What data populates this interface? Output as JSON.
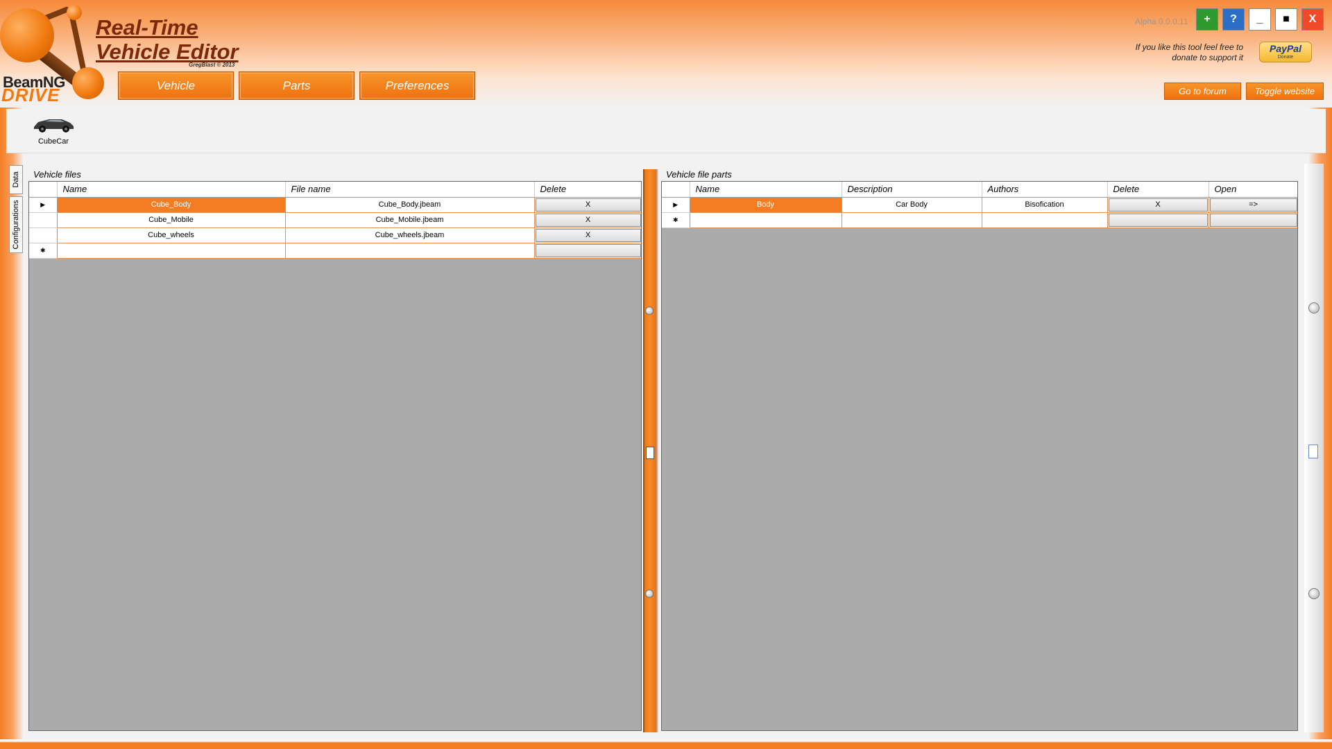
{
  "app": {
    "title_line1": "Real-Time",
    "title_line2": "Vehicle Editor",
    "credit": "GregBlast © 2013",
    "brand_name": "BeamNG",
    "brand_sub": "DRIVE",
    "version": "Alpha 0.0.0.11"
  },
  "nav": {
    "vehicle": "Vehicle",
    "parts": "Parts",
    "preferences": "Preferences"
  },
  "window_controls": {
    "add": "+",
    "help": "?",
    "minimize": "_",
    "maximize": "■",
    "close": "X"
  },
  "donate": {
    "text": "If you like this tool feel free to donate to support it",
    "paypal_label": "PayPal",
    "paypal_sub": "Donate"
  },
  "links": {
    "forum": "Go to forum",
    "toggle_website": "Toggle website"
  },
  "vehicles": [
    {
      "label": "CubeCar"
    }
  ],
  "side_tabs": {
    "data": "Data",
    "configurations": "Configurations"
  },
  "vehicle_files": {
    "title": "Vehicle files",
    "columns": {
      "name": "Name",
      "file_name": "File name",
      "delete": "Delete"
    },
    "rows": [
      {
        "name": "Cube_Body",
        "file_name": "Cube_Body.jbeam",
        "delete": "X",
        "selected": true
      },
      {
        "name": "Cube_Mobile",
        "file_name": "Cube_Mobile.jbeam",
        "delete": "X",
        "selected": false
      },
      {
        "name": "Cube_wheels",
        "file_name": "Cube_wheels.jbeam",
        "delete": "X",
        "selected": false
      }
    ],
    "new_row_marker": "✱",
    "current_row_marker": "▶"
  },
  "vehicle_file_parts": {
    "title": "Vehicle file parts",
    "columns": {
      "name": "Name",
      "description": "Description",
      "authors": "Authors",
      "delete": "Delete",
      "open": "Open"
    },
    "rows": [
      {
        "name": "Body",
        "description": "Car Body",
        "authors": "Bisofication",
        "delete": "X",
        "open": "=>",
        "selected": true
      }
    ],
    "new_row_marker": "✱",
    "current_row_marker": "▶"
  },
  "colors": {
    "accent": "#f47d23",
    "title": "#7a2a0a",
    "grid_bg": "#ababab"
  },
  "icons": {
    "car": "car-icon",
    "splitter_handle": "grip-icon"
  }
}
